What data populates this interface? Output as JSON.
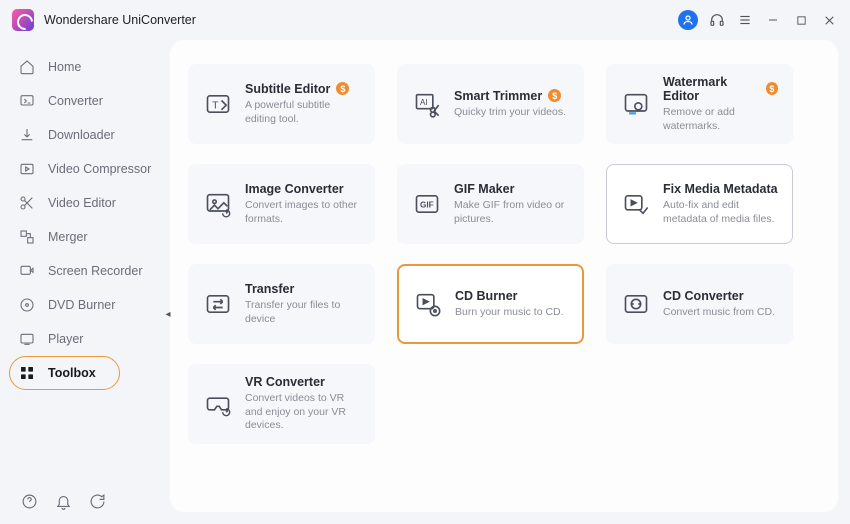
{
  "app": {
    "title": "Wondershare UniConverter"
  },
  "sidebar": {
    "items": [
      {
        "label": "Home"
      },
      {
        "label": "Converter"
      },
      {
        "label": "Downloader"
      },
      {
        "label": "Video Compressor"
      },
      {
        "label": "Video Editor"
      },
      {
        "label": "Merger"
      },
      {
        "label": "Screen Recorder"
      },
      {
        "label": "DVD Burner"
      },
      {
        "label": "Player"
      },
      {
        "label": "Toolbox"
      }
    ]
  },
  "cards": [
    {
      "title": "Subtitle Editor",
      "desc": "A powerful subtitle editing tool.",
      "badge": "$"
    },
    {
      "title": "Smart Trimmer",
      "desc": "Quicky trim your videos.",
      "badge": "$"
    },
    {
      "title": "Watermark Editor",
      "desc": "Remove or add watermarks.",
      "badge": "$"
    },
    {
      "title": "Image Converter",
      "desc": "Convert images to other formats.",
      "badge": ""
    },
    {
      "title": "GIF Maker",
      "desc": "Make GIF from video or pictures.",
      "badge": ""
    },
    {
      "title": "Fix Media Metadata",
      "desc": "Auto-fix and edit metadata of media files.",
      "badge": ""
    },
    {
      "title": "Transfer",
      "desc": "Transfer your files to device",
      "badge": ""
    },
    {
      "title": "CD Burner",
      "desc": "Burn your music to CD.",
      "badge": ""
    },
    {
      "title": "CD Converter",
      "desc": "Convert music from CD.",
      "badge": ""
    },
    {
      "title": "VR Converter",
      "desc": "Convert videos to VR and enjoy on your VR devices.",
      "badge": ""
    }
  ]
}
